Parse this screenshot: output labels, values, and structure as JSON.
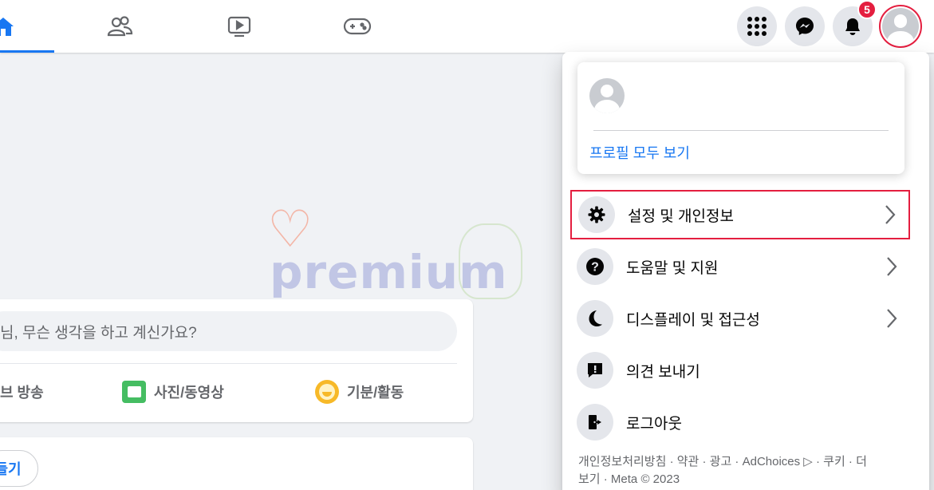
{
  "topbar": {
    "tabs": [
      {
        "name": "home",
        "icon": "home-icon",
        "active": true
      },
      {
        "name": "friends",
        "icon": "friends-icon",
        "active": false
      },
      {
        "name": "watch",
        "icon": "watch-icon",
        "active": false
      },
      {
        "name": "gaming",
        "icon": "gaming-icon",
        "active": false
      }
    ],
    "notification_count": "5",
    "accent_color": "#1877f2",
    "highlight_color": "#e41e3f"
  },
  "watermark": {
    "text": "premium"
  },
  "composer": {
    "placeholder": "님, 무슨 생각을 하고 계신가요?",
    "actions": [
      {
        "label": "브 방송",
        "icon": "live-video-icon"
      },
      {
        "label": "사진/동영상",
        "icon": "photo-icon"
      },
      {
        "label": "기분/활동",
        "icon": "feeling-icon"
      }
    ]
  },
  "card2": {
    "button_label": "들기"
  },
  "dropdown": {
    "profile_link": "프로필 모두 보기",
    "menu": [
      {
        "label": "설정 및 개인정보",
        "icon": "gear-icon",
        "has_chevron": true,
        "highlighted": true
      },
      {
        "label": "도움말 및 지원",
        "icon": "question-icon",
        "has_chevron": true,
        "highlighted": false
      },
      {
        "label": "디스플레이 및 접근성",
        "icon": "moon-icon",
        "has_chevron": true,
        "highlighted": false
      },
      {
        "label": "의견 보내기",
        "icon": "feedback-icon",
        "has_chevron": false,
        "highlighted": false
      },
      {
        "label": "로그아웃",
        "icon": "logout-icon",
        "has_chevron": false,
        "highlighted": false
      }
    ],
    "footer_line1": "개인정보처리방침 · 약관 · 광고 · AdChoices ▷ · 쿠키 · 더",
    "footer_line2": "보기 · Meta © 2023"
  }
}
